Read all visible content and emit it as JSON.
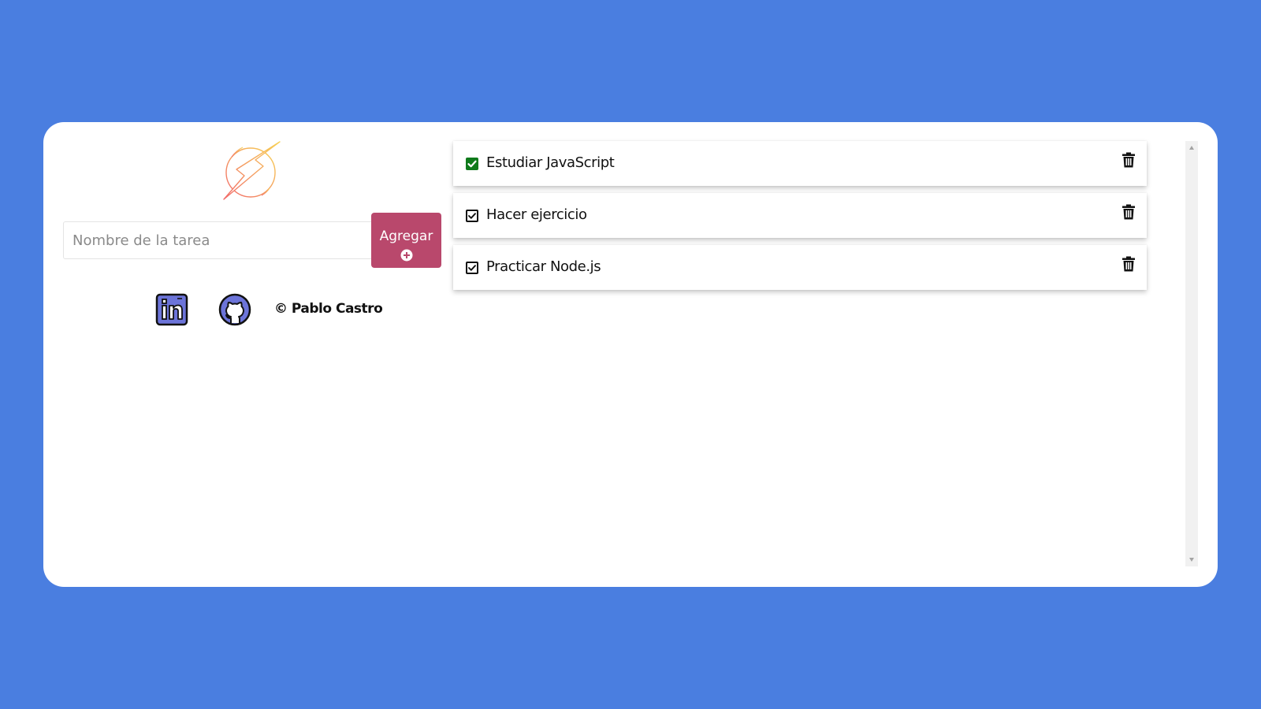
{
  "colors": {
    "background": "#4a7ee0",
    "card": "#ffffff",
    "accent_button": "#b9486c",
    "done_check": "#0f7a1b",
    "icon_fill": "#6c74d9"
  },
  "logo": {
    "icon": "lightning-bolt-circle-icon"
  },
  "form": {
    "input_placeholder": "Nombre de la tarea",
    "input_value": "",
    "add_label": "Agregar",
    "add_icon": "plus-circle-icon"
  },
  "footer": {
    "linkedin_icon": "linkedin-icon",
    "github_icon": "github-icon",
    "copyright": "© Pablo Castro"
  },
  "tasks": [
    {
      "text": "Estudiar JavaScript",
      "done": true,
      "delete_icon": "trash-icon"
    },
    {
      "text": "Hacer ejercicio",
      "done": false,
      "delete_icon": "trash-icon"
    },
    {
      "text": "Practicar Node.js",
      "done": false,
      "delete_icon": "trash-icon"
    }
  ]
}
